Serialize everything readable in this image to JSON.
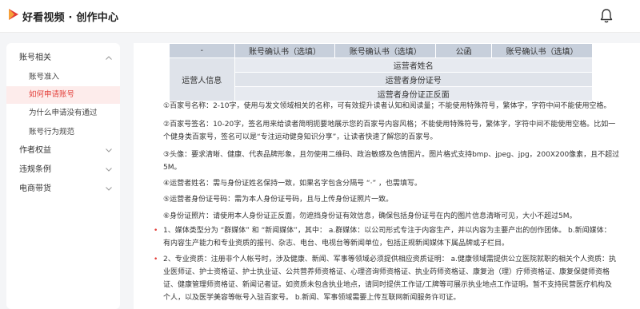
{
  "header": {
    "brand": "好看视频 · 创作中心",
    "brand_color": "#e23b36"
  },
  "sidebar": {
    "groups": [
      {
        "label": "账号相关",
        "expanded": true,
        "items": [
          {
            "label": "账号准入",
            "active": false
          },
          {
            "label": "如何申请账号",
            "active": true
          },
          {
            "label": "为什么申请没有通过",
            "active": false
          },
          {
            "label": "账号行为规范",
            "active": false
          }
        ]
      },
      {
        "label": "作者权益",
        "expanded": false
      },
      {
        "label": "违规条例",
        "expanded": false
      },
      {
        "label": "电商带货",
        "expanded": false
      }
    ]
  },
  "table": {
    "header": [
      "-",
      "账号确认书（选填）",
      "账号确认书（选填）",
      "公函",
      "账号确认书（选填）"
    ],
    "group_label": "运营人信息",
    "rows": [
      "运营者姓名",
      "运营者身份证号",
      "运营者身份证正反面"
    ]
  },
  "notes": [
    "①百家号名称：2-10字，使用与发文领域相关的名称，可有效提升读者认知和阅读量；不能使用特殊符号，繁体字，字符中间不能使用空格。",
    "②百家号签名：10-20字，签名用来给读者简明扼要地展示您的百家号内容风格；不能使用特殊符号，繁体字，字符中间不能使用空格。比如一",
    "个健身类百家号，签名可以是“专注运动健身知识分享”，让读者快速了解您的百家号。",
    "③头像：要求清晰、健康、代表品牌形象，且勿使用二维码、政治敏感及色情图片。图片格式支持bmp、jpeg、jpg，200X200像素，且不超过",
    "5M。",
    "④运营者姓名：需与身份证姓名保持一致，如果名字包含分隔号 “·” ，也需填写。",
    "⑤运营者身份证号码：需为本人身份证号码，且与上传身份证照片一致。",
    "⑥身份证照片：请使用本人身份证正反面，勿遮挡身份证有效信息，确保包括身份证号在内的图片信息清晰可见，大小不超过5M。"
  ],
  "bullets": [
    [
      "1、媒体类型分为 “群媒体” 和 “新闻媒体”，其中： a.群媒体：以公司形式专注于内容生产，并以内容为主要产出的创作团体。 b.新闻媒体：",
      "有内容生产能力和专业资质的报刊、杂志、电台、电视台等新闻单位，包括正规新闻媒体下属品牌或子栏目。"
    ],
    [
      "2、专业资质：注册非个人帐号时，涉及健康、新闻、军事等领域必须提供相应资质证明： a.健康领域需提供公立医院就职的相关个人资质：执",
      "业医师证、护士资格证、护士执业证、公共营养师资格证、心理咨询师资格证、执业药师资格证、康复治（理）疗师资格证、康复保健师资格",
      "证、健康管理师资格证、新闻记者证。如资质未包含执业地点，请同时提供工作证/工牌等可展示执业地点工作证明。暂不支持民营医疗机构及",
      "个人，以及医学美容等帐号入驻百家号。 b.新闻、军事领域需要上传互联网新闻服务许可证。"
    ]
  ]
}
